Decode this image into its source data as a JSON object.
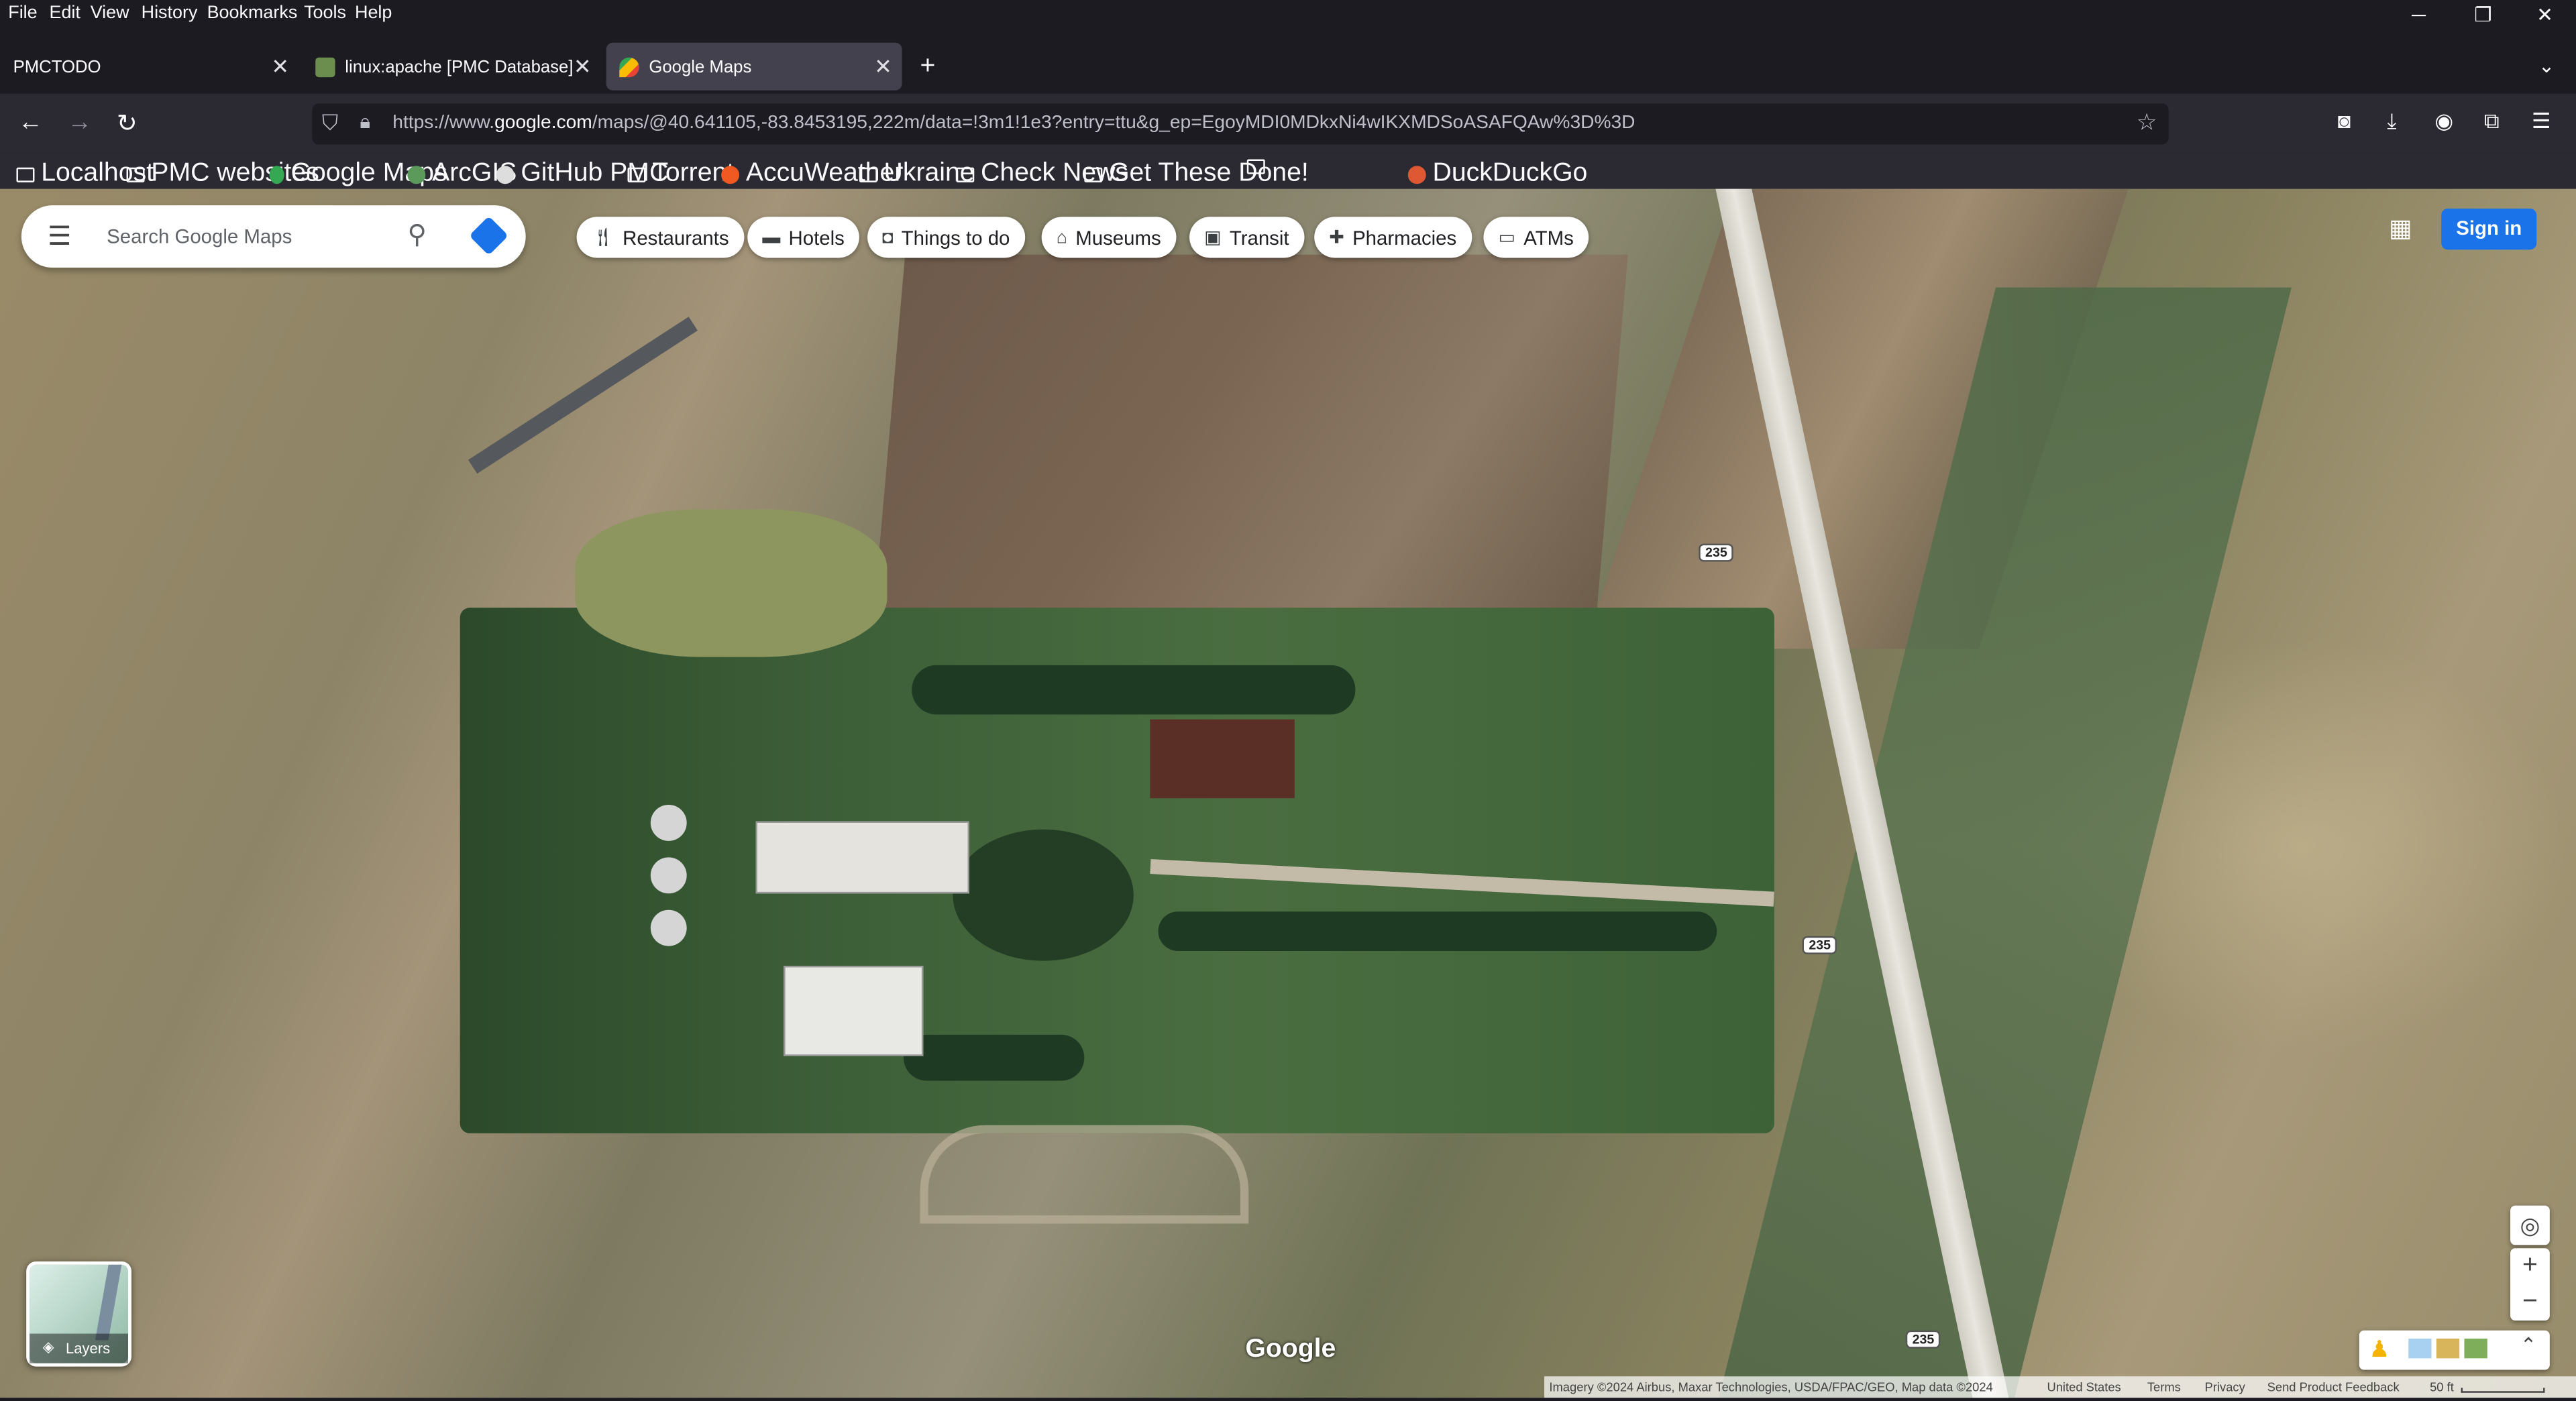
{
  "menu": [
    "File",
    "Edit",
    "View",
    "History",
    "Bookmarks",
    "Tools",
    "Help"
  ],
  "window_controls": {
    "minimize": "─",
    "restore": "❐",
    "close": "✕"
  },
  "tabs": [
    {
      "label": "PMCTODO",
      "selected": false
    },
    {
      "label": "linux:apache [PMC Database]",
      "selected": false
    },
    {
      "label": "Google Maps",
      "selected": true
    }
  ],
  "new_tab": "+",
  "url": {
    "prefix": "https://www.",
    "domain": "google.com",
    "rest": "/maps/@40.641105,-83.8453195,222m/data=!3m1!1e3?entry=ttu&g_ep=EgoyMDI0MDkxNi4wIKXMDSoASAFQAw%3D%3D"
  },
  "bookmarks": [
    {
      "label": "Localhost",
      "icon": "folder-icon"
    },
    {
      "label": "PMC websites",
      "icon": "folder-icon"
    },
    {
      "label": "Google Maps",
      "icon": "maps-pin-icon"
    },
    {
      "label": "ArcGIS",
      "icon": "arcgis-icon"
    },
    {
      "label": "GitHub PMC",
      "icon": "github-icon"
    },
    {
      "label": "Torrent",
      "icon": "folder-icon"
    },
    {
      "label": "AccuWeather",
      "icon": "accuweather-icon"
    },
    {
      "label": "Ukraine",
      "icon": "folder-icon"
    },
    {
      "label": "Check News",
      "icon": "folder-icon"
    },
    {
      "label": "Get These Done!",
      "icon": "folder-icon"
    },
    {
      "label": "",
      "icon": "folder-icon"
    },
    {
      "label": "DuckDuckGo",
      "icon": "duckduckgo-icon"
    }
  ],
  "maps": {
    "search_placeholder": "Search Google Maps",
    "chips": [
      {
        "label": "Restaurants",
        "icon": "fork-knife-icon"
      },
      {
        "label": "Hotels",
        "icon": "bed-icon"
      },
      {
        "label": "Things to do",
        "icon": "camera-icon"
      },
      {
        "label": "Museums",
        "icon": "museum-icon"
      },
      {
        "label": "Transit",
        "icon": "train-icon"
      },
      {
        "label": "Pharmacies",
        "icon": "pharmacy-icon"
      },
      {
        "label": "ATMs",
        "icon": "atm-icon"
      }
    ],
    "sign_in": "Sign in",
    "road_shield": "235",
    "layers_label": "Layers",
    "logo": "Google",
    "attribution": {
      "imagery": "Imagery ©2024 Airbus, Maxar Technologies, USDA/FPAC/GEO, Map data ©2024",
      "region": "United States",
      "terms": "Terms",
      "privacy": "Privacy",
      "feedback": "Send Product Feedback",
      "scale": "50 ft"
    }
  },
  "colors": {
    "maps_blue": "#1a73e8",
    "firefox_dark": "#1c1b22",
    "toolbar": "#2b2a33"
  }
}
